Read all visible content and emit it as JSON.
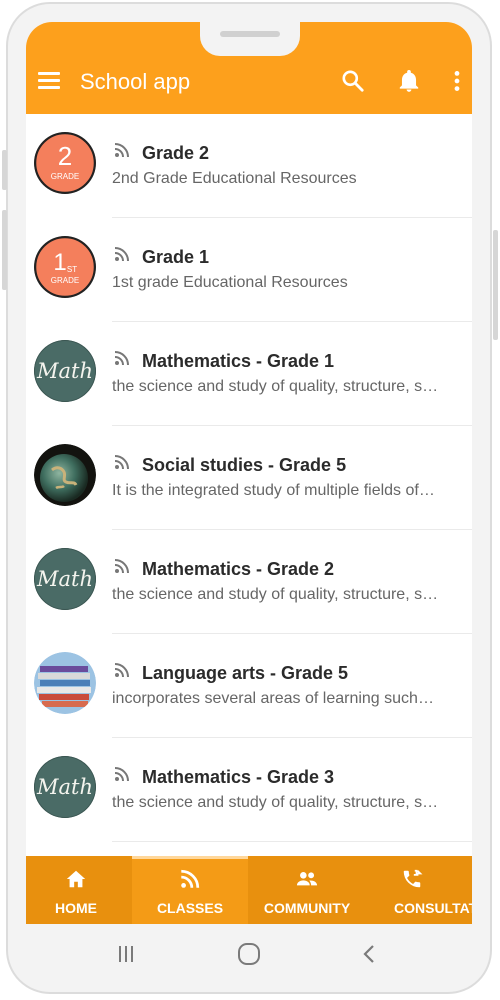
{
  "app": {
    "title": "School app",
    "accent": "#fda01c",
    "nav_color": "#e8900e"
  },
  "appbar": {
    "icons": [
      "menu-icon",
      "search-icon",
      "bell-icon",
      "more-vert-icon"
    ]
  },
  "classes": [
    {
      "title": "Grade 2",
      "subtitle": "2nd Grade Educational Resources",
      "avatar": "grade-2",
      "badge_main": "2",
      "badge_sub": "GRADE"
    },
    {
      "title": "Grade 1",
      "subtitle": "1st grade Educational Resources",
      "avatar": "grade-1",
      "badge_main": "1",
      "badge_sup": "ST",
      "badge_sub": "GRADE"
    },
    {
      "title": "Mathematics - Grade 1",
      "subtitle": "the science and study of quality, structure, s…",
      "avatar": "math",
      "badge_main": "Math"
    },
    {
      "title": "Social studies - Grade 5",
      "subtitle": "It is the integrated study of multiple fields of…",
      "avatar": "globe"
    },
    {
      "title": "Mathematics - Grade 2",
      "subtitle": "the science and study of quality, structure, s…",
      "avatar": "math",
      "badge_main": "Math"
    },
    {
      "title": "Language arts - Grade 5",
      "subtitle": "incorporates several areas of learning such…",
      "avatar": "books"
    },
    {
      "title": "Mathematics - Grade 3",
      "subtitle": "the science and study of quality, structure, s…",
      "avatar": "math",
      "badge_main": "Math"
    }
  ],
  "tabs": [
    {
      "label": "HOME",
      "icon": "home-icon"
    },
    {
      "label": "CLASSES",
      "icon": "feed-icon",
      "active": true
    },
    {
      "label": "COMMUNITY",
      "icon": "people-icon"
    },
    {
      "label": "CONSULTATION",
      "icon": "phone-forward-icon"
    }
  ],
  "system_nav": [
    "recents-icon",
    "home-circle-icon",
    "back-icon"
  ]
}
